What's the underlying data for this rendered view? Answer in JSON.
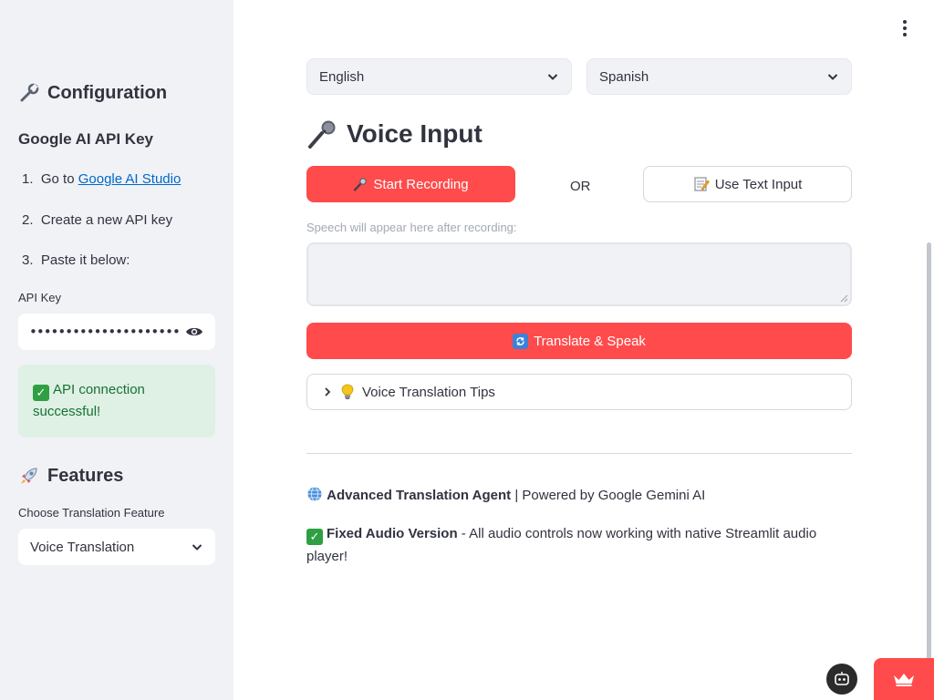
{
  "sidebar": {
    "config_title": "Configuration",
    "api_key_heading": "Google AI API Key",
    "steps": [
      {
        "num": "1.",
        "text": "Go to ",
        "link": "Google AI Studio"
      },
      {
        "num": "2.",
        "text": "Create a new API key"
      },
      {
        "num": "3.",
        "text": "Paste it below:"
      }
    ],
    "api_key_label": "API Key",
    "api_key_value": "••••••••••••••••••••••••••••••••••••••",
    "success_message": "API connection successful!",
    "features_title": "Features",
    "feature_label": "Choose Translation Feature",
    "feature_selected": "Voice Translation"
  },
  "main": {
    "source_language": "English",
    "target_language": "Spanish",
    "section_title": "Voice Input",
    "start_recording": "Start Recording",
    "or_text": "OR",
    "use_text_input": "Use Text Input",
    "speech_hint": "Speech will appear here after recording:",
    "speech_text": "",
    "translate_button": "Translate & Speak",
    "tips_label": "Voice Translation Tips"
  },
  "footer": {
    "line1_bold": "Advanced Translation Agent",
    "line1_rest": " | Powered by Google Gemini AI",
    "line2_bold": "Fixed Audio Version",
    "line2_rest": " - All audio controls now working with native Streamlit audio player!"
  },
  "colors": {
    "primary": "#ff4b4b",
    "sidebar_bg": "#f0f2f6",
    "success_bg": "#dff0e5",
    "success_text": "#177233",
    "link": "#0068c9"
  },
  "icons": {
    "config": "wrench-icon",
    "features": "rocket-icon",
    "voice": "microphone-icon",
    "tips": "lightbulb-icon",
    "footer_globe": "globe-icon",
    "footer_check": "check-icon"
  }
}
